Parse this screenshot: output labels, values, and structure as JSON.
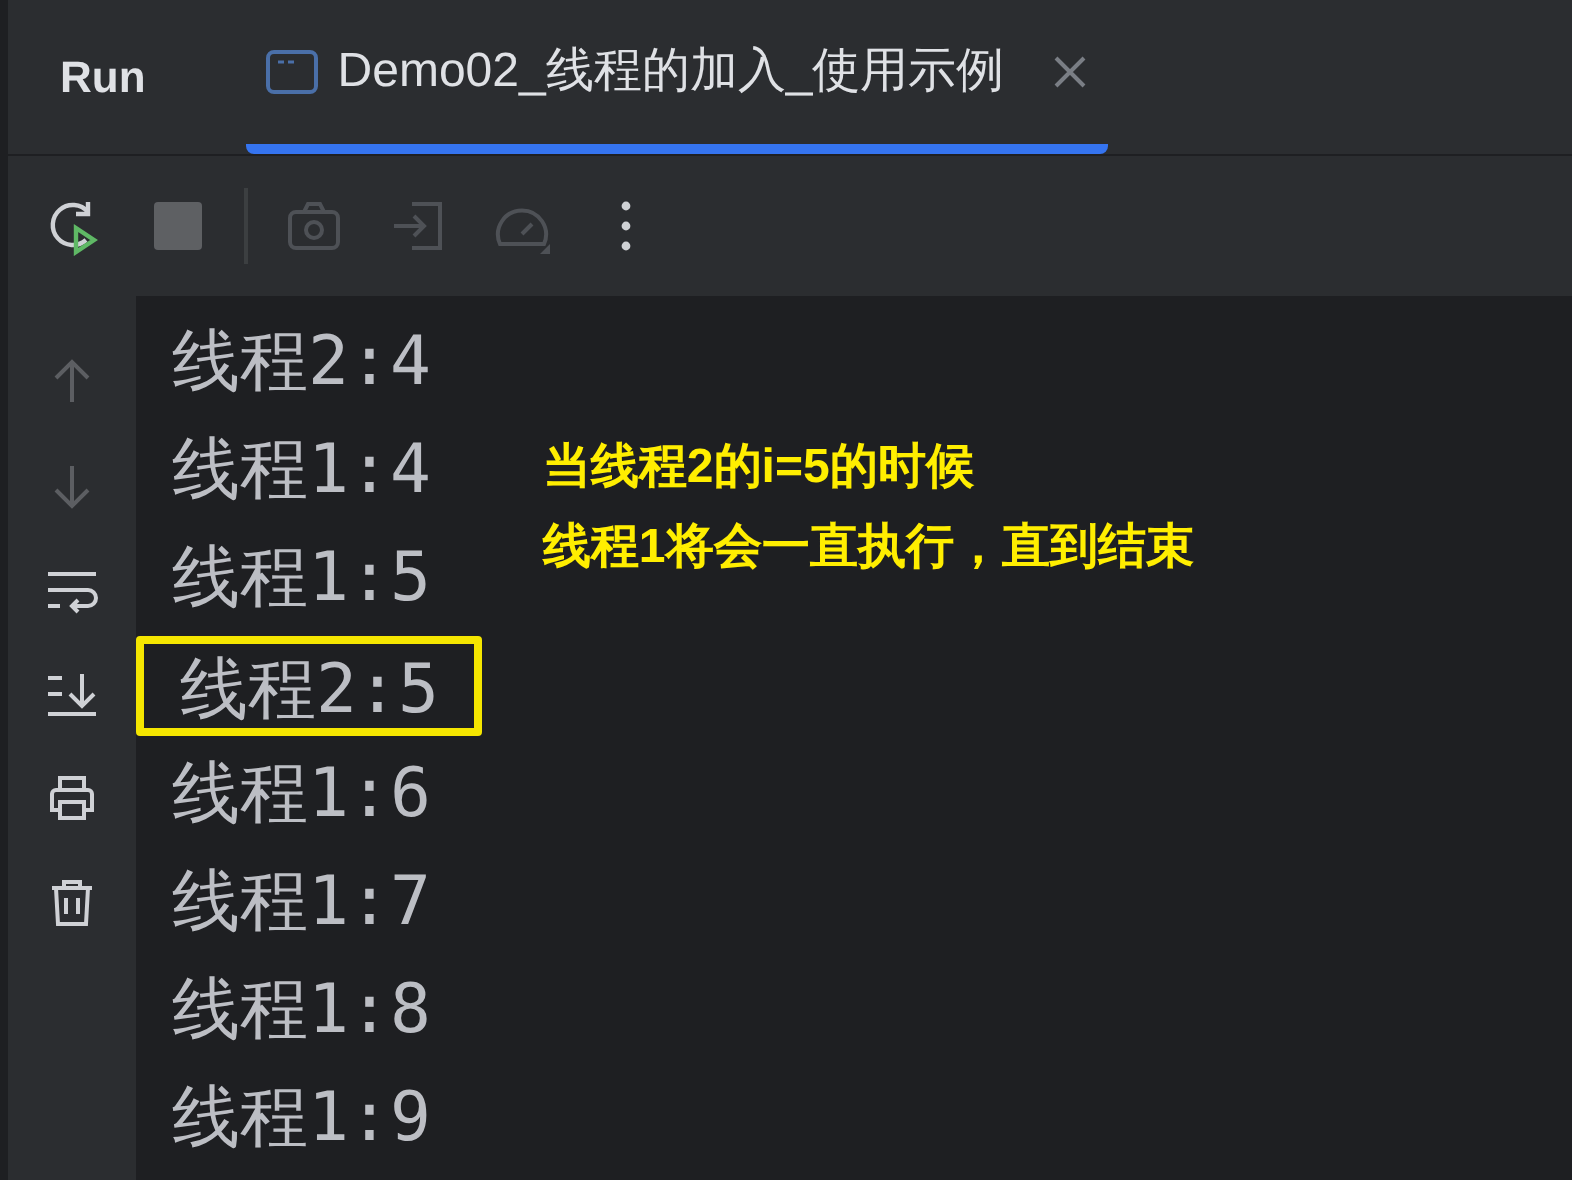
{
  "panel": {
    "title": "Run"
  },
  "tabs": [
    {
      "label": "Demo02_线程的加入_使用示例",
      "selected": true,
      "closable": true
    }
  ],
  "toolbar": [
    {
      "kind": "rerun",
      "disabled": false
    },
    {
      "kind": "stop",
      "disabled": true
    },
    {
      "kind": "separator"
    },
    {
      "kind": "camera",
      "disabled": true
    },
    {
      "kind": "exit",
      "disabled": true
    },
    {
      "kind": "gauge",
      "disabled": true
    },
    {
      "kind": "more",
      "disabled": false
    }
  ],
  "gutter": [
    {
      "kind": "up",
      "disabled": true
    },
    {
      "kind": "down",
      "disabled": true
    },
    {
      "kind": "wrap",
      "disabled": false
    },
    {
      "kind": "scroll-end",
      "disabled": false
    },
    {
      "kind": "print",
      "disabled": false
    },
    {
      "kind": "trash",
      "disabled": false
    }
  ],
  "console_lines": [
    {
      "text": "线程2:4",
      "highlighted": false
    },
    {
      "text": "线程1:4",
      "highlighted": false
    },
    {
      "text": "线程1:5",
      "highlighted": false
    },
    {
      "text": "线程2:5",
      "highlighted": true
    },
    {
      "text": "线程1:6",
      "highlighted": false
    },
    {
      "text": "线程1:7",
      "highlighted": false
    },
    {
      "text": "线程1:8",
      "highlighted": false
    },
    {
      "text": "线程1:9",
      "highlighted": false
    }
  ],
  "annotation": [
    "当线程2的i=5的时候",
    "线程1将会一直执行，直到结束"
  ]
}
